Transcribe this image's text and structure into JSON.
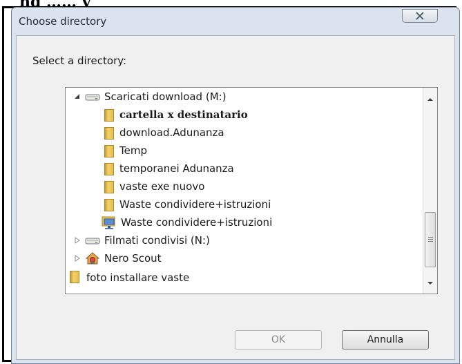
{
  "header_caption": "ng …… y",
  "window": {
    "title": "Choose directory",
    "close_icon": "close-x-icon"
  },
  "dialog": {
    "prompt": "Select a directory:"
  },
  "tree": {
    "items": [
      {
        "label": "Scaricati  download (M:)",
        "icon": "drive-icon",
        "expander": "expanded"
      },
      {
        "label": "cartella x destinatario",
        "icon": "folder-icon"
      },
      {
        "label": "download.Adunanza",
        "icon": "folder-icon"
      },
      {
        "label": "Temp",
        "icon": "folder-icon"
      },
      {
        "label": "temporanei Adunanza",
        "icon": "folder-icon"
      },
      {
        "label": "vaste exe  nuovo",
        "icon": "folder-icon"
      },
      {
        "label": "Waste condividere+istruzioni",
        "icon": "folder-icon"
      },
      {
        "label": "Waste condividere+istruzioni",
        "icon": "network-folder-icon"
      },
      {
        "label": "Filmati condivisi (N:)",
        "icon": "drive-icon",
        "expander": "collapsed"
      },
      {
        "label": "Nero Scout",
        "icon": "nero-scout-icon",
        "expander": "collapsed"
      },
      {
        "label": "foto installare vaste",
        "icon": "folder-icon"
      }
    ]
  },
  "buttons": {
    "ok_label": "OK",
    "cancel_label": "Annulla"
  }
}
